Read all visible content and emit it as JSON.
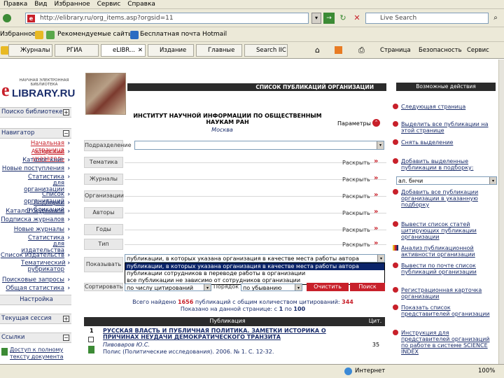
{
  "browser": {
    "menu": [
      "Правка",
      "Вид",
      "Избранное",
      "Сервис",
      "Справка"
    ],
    "address": "http://elibrary.ru/org_items.asp?orgsid=11",
    "live_search": "Live Search",
    "favorites_label": "Избранное",
    "fav_links": [
      "Рекомендуемые сайты",
      "Бесплатная почта Hotmail"
    ],
    "tabs": [
      "Журналы",
      "РГИА",
      "eLIBR...",
      "Издание",
      "Главные",
      "Search IIC"
    ],
    "toolbar_right": [
      "Страница",
      "Безопасность",
      "Сервис"
    ],
    "status_zone": "Интернет",
    "zoom": "100%"
  },
  "site": {
    "logo_small": "НАУЧНАЯ ЭЛЕКТРОННАЯ\nБИБЛИОТЕКА",
    "logo_big": "LIBRARY.RU",
    "logo_letter": "e"
  },
  "sidebar": {
    "search_head": "Поиско библиотеке",
    "nav_head": "Навигатор",
    "nav_items": [
      "Начальная страница",
      "Авторский указатель",
      "Каталог книг",
      "Новые поступления",
      "Статистика для организации",
      "Список организаций",
      "Подборки публикаций",
      "Каталог журналов",
      "Подписка журналов",
      "Новые журналы",
      "Статистика для издательства",
      "Список издательств",
      "Тематический рубрикатор",
      "Поисковые запросы",
      "Общая статистика"
    ],
    "settings": "Настройка",
    "session_head": "Текущая сессия",
    "links_head": "Ссылки",
    "links_items": [
      "Доступ к полному тексту документа"
    ]
  },
  "main": {
    "title": "СПИСОК ПУБЛИКАЦИЙ ОРГАНИЗАЦИИ",
    "org_name": "ИНСТИТУТ НАУЧНОЙ ИНФОРМАЦИИ ПО ОБЩЕСТВЕННЫМ НАУКАМ РАН",
    "org_city": "Москва",
    "params": "Параметры",
    "filters": [
      {
        "label": "Подразделение",
        "type": "select"
      },
      {
        "label": "Тематика",
        "type": "expand"
      },
      {
        "label": "Журналы",
        "type": "expand"
      },
      {
        "label": "Организации",
        "type": "expand"
      },
      {
        "label": "Авторы",
        "type": "expand"
      },
      {
        "label": "Годы",
        "type": "expand"
      },
      {
        "label": "Тип",
        "type": "expand"
      }
    ],
    "expand_label": "Раскрыть",
    "show_label": "Показывать",
    "show_value": "публикации, в которых указана организация в качестве места работы автора",
    "show_options": [
      "публикации, в которых указана организация в качестве места работы автора",
      "публикации сотрудников в переводе работы в организации",
      "все публикации не зависимо от сотрудников организации"
    ],
    "sort_label": "Сортировать",
    "sort_value": "по числу цитирований",
    "order_label": "Порядок",
    "order_value": "по убыванию",
    "clear_button": "Очистить",
    "search_button": "Поиск",
    "total_text_1": "Всего найдено ",
    "total_count": "1656",
    "total_text_2": " публикаций с общим количеством цитирований: ",
    "total_cites": "344",
    "shown_text": "Показано на данной странице: с ",
    "shown_from": "1",
    "shown_mid": " по ",
    "shown_to": "100",
    "table_header": "Публикация",
    "table_cit": "Цит.",
    "rows": [
      {
        "num": "1",
        "title": "РУССКАЯ ВЛАСТЬ И ПУБЛИЧНАЯ ПОЛИТИКА. ЗАМЕТКИ ИСТОРИКА О ПРИЧИНАХ НЕУДАЧИ ДЕМОКРАТИЧЕСКОГО ТРАНЗИТА",
        "author": "Пивоваров Ю.С.",
        "source": "Полис (Политические исследования). 2006. № 1. С. 12-32.",
        "cites": "35"
      }
    ]
  },
  "actions": {
    "head": "Возможные действия",
    "items": [
      "Следующая страница",
      "Выделить все публикации на этой странице",
      "Снять выделение",
      "Добавить выделенные публикации в подборку:",
      "Добавить все публикации организации в указанную подборку",
      "Вывести список статей цитирующих публикации организации",
      "Анализ публикационной активности организации",
      "Вывести по почте список публикаций организации",
      "Регистрационная карточка организации",
      "Показать список представителей организации",
      "Инструкция для представителей организаций по работе в системе SCIENCE INDEX"
    ],
    "select_value": "ал. бнчи"
  },
  "colors": {
    "accent": "#c8202a",
    "nav_blue": "#1a2d6b",
    "header_bar": "#2b2b2b"
  }
}
